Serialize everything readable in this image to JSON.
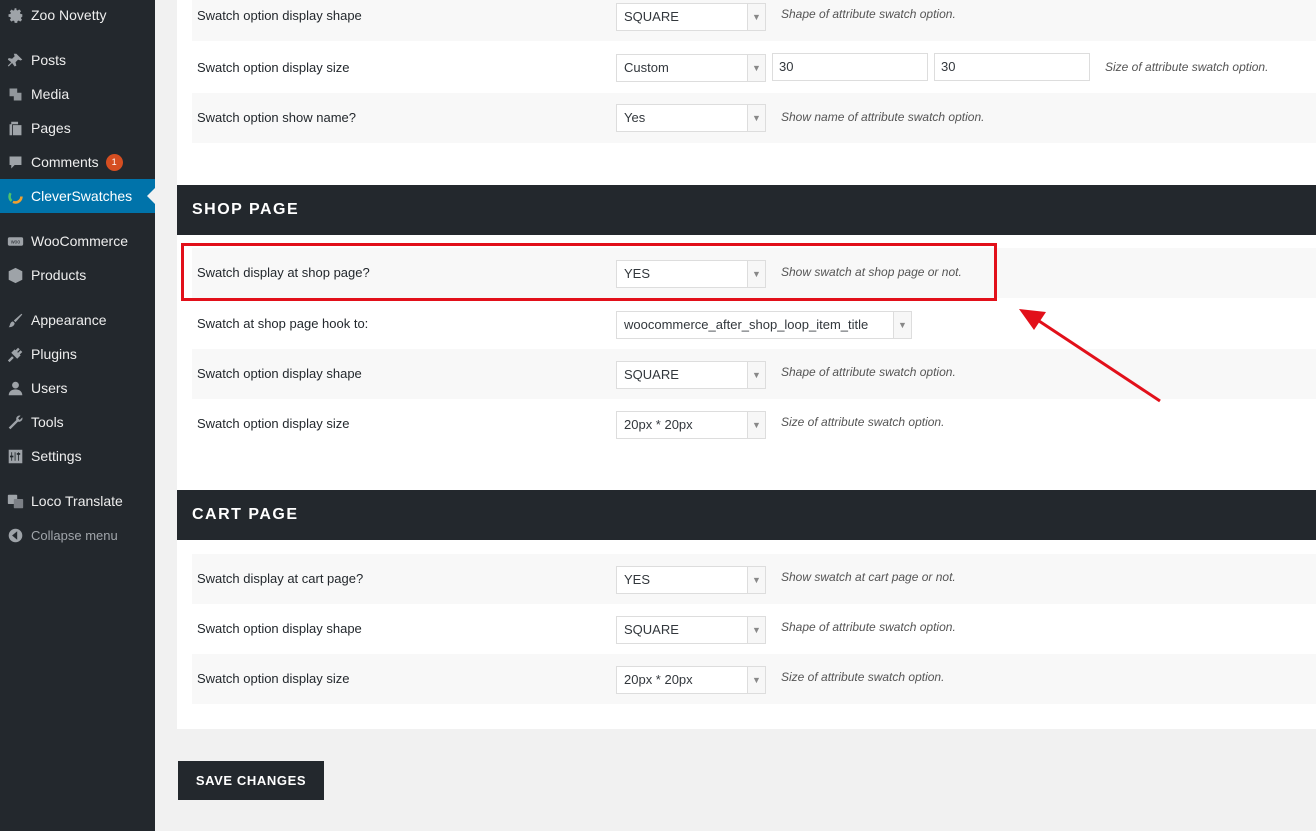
{
  "sidebar": {
    "site": "Zoo Novetty",
    "items": [
      {
        "label": "Posts",
        "icon": "pin-icon"
      },
      {
        "label": "Media",
        "icon": "media-icon"
      },
      {
        "label": "Pages",
        "icon": "pages-icon"
      },
      {
        "label": "Comments",
        "icon": "comment-icon",
        "badge": "1"
      },
      {
        "label": "CleverSwatches",
        "icon": "cleverswatches-icon",
        "active": true
      },
      {
        "label": "WooCommerce",
        "icon": "woo-icon"
      },
      {
        "label": "Products",
        "icon": "box-icon"
      },
      {
        "label": "Appearance",
        "icon": "brush-icon"
      },
      {
        "label": "Plugins",
        "icon": "plug-icon"
      },
      {
        "label": "Users",
        "icon": "user-icon"
      },
      {
        "label": "Tools",
        "icon": "wrench-icon"
      },
      {
        "label": "Settings",
        "icon": "sliders-icon"
      },
      {
        "label": "Loco Translate",
        "icon": "translate-icon"
      }
    ],
    "collapse_label": "Collapse menu"
  },
  "general": {
    "shape": {
      "label": "Swatch option display shape",
      "value": "SQUARE",
      "desc": "Shape of attribute swatch option."
    },
    "size": {
      "label": "Swatch option display size",
      "value": "Custom",
      "width": "30",
      "height": "30",
      "desc": "Size of attribute swatch option."
    },
    "show_name": {
      "label": "Swatch option show name?",
      "value": "Yes",
      "desc": "Show name of attribute swatch option."
    }
  },
  "shop": {
    "title": "SHOP PAGE",
    "display": {
      "label": "Swatch display at shop page?",
      "value": "YES",
      "desc": "Show swatch at shop page or not."
    },
    "hook": {
      "label": "Swatch at shop page hook to:",
      "value": "woocommerce_after_shop_loop_item_title"
    },
    "shape": {
      "label": "Swatch option display shape",
      "value": "SQUARE",
      "desc": "Shape of attribute swatch option."
    },
    "size": {
      "label": "Swatch option display size",
      "value": "20px * 20px",
      "desc": "Size of attribute swatch option."
    }
  },
  "cart": {
    "title": "CART PAGE",
    "display": {
      "label": "Swatch display at cart page?",
      "value": "YES",
      "desc": "Show swatch at cart page or not."
    },
    "shape": {
      "label": "Swatch option display shape",
      "value": "SQUARE",
      "desc": "Shape of attribute swatch option."
    },
    "size": {
      "label": "Swatch option display size",
      "value": "20px * 20px",
      "desc": "Size of attribute swatch option."
    }
  },
  "save_label": "SAVE CHANGES",
  "colors": {
    "sidebar": "#23282d",
    "active": "#0073aa",
    "annotation": "#e2101a"
  }
}
